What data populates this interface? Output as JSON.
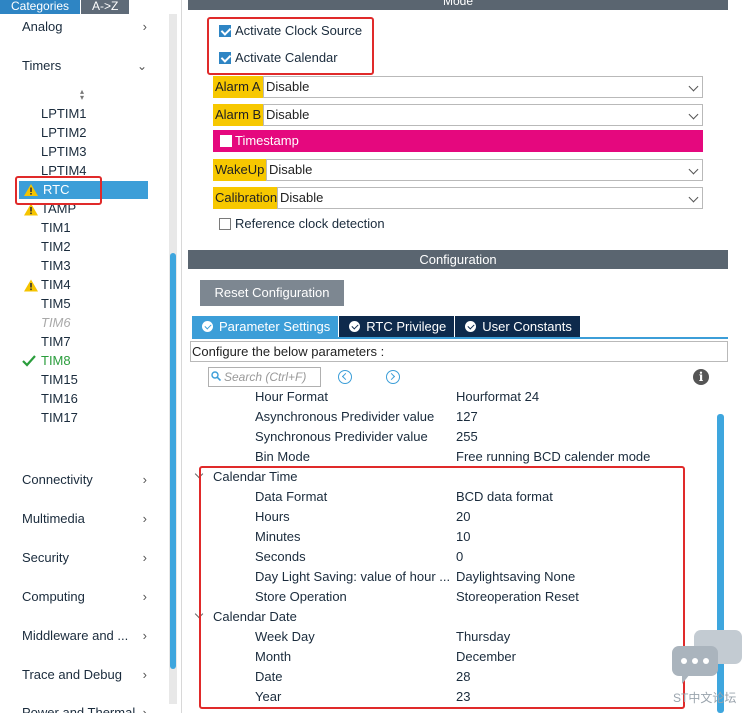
{
  "sidebar": {
    "tabs": [
      "Categories",
      "A->Z"
    ],
    "categories_top": [
      {
        "label": "Analog",
        "expanded": false
      },
      {
        "label": "Timers",
        "expanded": true
      }
    ],
    "timer_items": [
      {
        "label": "LPTIM1",
        "status": "normal"
      },
      {
        "label": "LPTIM2",
        "status": "normal"
      },
      {
        "label": "LPTIM3",
        "status": "normal"
      },
      {
        "label": "LPTIM4",
        "status": "normal"
      },
      {
        "label": "RTC",
        "status": "warning-selected"
      },
      {
        "label": "TAMP",
        "status": "warning"
      },
      {
        "label": "TIM1",
        "status": "normal"
      },
      {
        "label": "TIM2",
        "status": "normal"
      },
      {
        "label": "TIM3",
        "status": "normal"
      },
      {
        "label": "TIM4",
        "status": "warning"
      },
      {
        "label": "TIM5",
        "status": "normal"
      },
      {
        "label": "TIM6",
        "status": "disabled"
      },
      {
        "label": "TIM7",
        "status": "normal"
      },
      {
        "label": "TIM8",
        "status": "ok"
      },
      {
        "label": "TIM15",
        "status": "normal"
      },
      {
        "label": "TIM16",
        "status": "normal"
      },
      {
        "label": "TIM17",
        "status": "normal"
      }
    ],
    "categories_bottom": [
      {
        "label": "Connectivity"
      },
      {
        "label": "Multimedia"
      },
      {
        "label": "Security"
      },
      {
        "label": "Computing"
      },
      {
        "label": "Middleware and ..."
      },
      {
        "label": "Trace and Debug"
      },
      {
        "label": "Power and Thermal"
      }
    ]
  },
  "mode": {
    "header": "Mode",
    "activate_clock_source": {
      "label": "Activate Clock Source",
      "checked": true
    },
    "activate_calendar": {
      "label": "Activate Calendar",
      "checked": true
    },
    "alarm_a": {
      "label": "Alarm A",
      "value": "Disable"
    },
    "alarm_b": {
      "label": "Alarm B",
      "value": "Disable"
    },
    "timestamp": {
      "label": "Timestamp",
      "checked": false
    },
    "wakeup": {
      "label": "WakeUp",
      "value": "Disable"
    },
    "calibration": {
      "label": "Calibration",
      "value": "Disable"
    },
    "reference_clock": {
      "label": "Reference clock detection",
      "checked": false
    }
  },
  "configuration": {
    "header": "Configuration",
    "reset_button": "Reset Configuration",
    "tabs": [
      {
        "label": "Parameter Settings",
        "active": true
      },
      {
        "label": "RTC Privilege",
        "active": false
      },
      {
        "label": "User Constants",
        "active": false
      }
    ],
    "hint": "Configure the below parameters :",
    "search_placeholder": "Search (Ctrl+F)",
    "general_params": [
      {
        "key": "Hour Format",
        "value": "Hourformat 24"
      },
      {
        "key": "Asynchronous Predivider value",
        "value": "127"
      },
      {
        "key": "Synchronous Predivider value",
        "value": "255"
      },
      {
        "key": "Bin Mode",
        "value": "Free running BCD calender mode"
      }
    ],
    "calendar_time": {
      "title": "Calendar Time",
      "params": [
        {
          "key": "Data Format",
          "value": "BCD data format"
        },
        {
          "key": "Hours",
          "value": "20"
        },
        {
          "key": "Minutes",
          "value": "10"
        },
        {
          "key": "Seconds",
          "value": "0"
        },
        {
          "key": "Day Light Saving: value of hour ...",
          "value": "Daylightsaving None"
        },
        {
          "key": "Store Operation",
          "value": "Storeoperation Reset"
        }
      ]
    },
    "calendar_date": {
      "title": "Calendar Date",
      "params": [
        {
          "key": "Week Day",
          "value": "Thursday"
        },
        {
          "key": "Month",
          "value": "December"
        },
        {
          "key": "Date",
          "value": "28"
        },
        {
          "key": "Year",
          "value": "23"
        }
      ]
    }
  },
  "watermark": "ST中文论坛",
  "colors": {
    "accent_blue": "#3c9ed8",
    "header_gray": "#5a6570",
    "mode_yellow": "#f7c800",
    "timestamp_magenta": "#e5087e",
    "annotation_red": "#e02a2a",
    "warning_yellow": "#f5c400",
    "ok_green": "#2a9d3c"
  }
}
